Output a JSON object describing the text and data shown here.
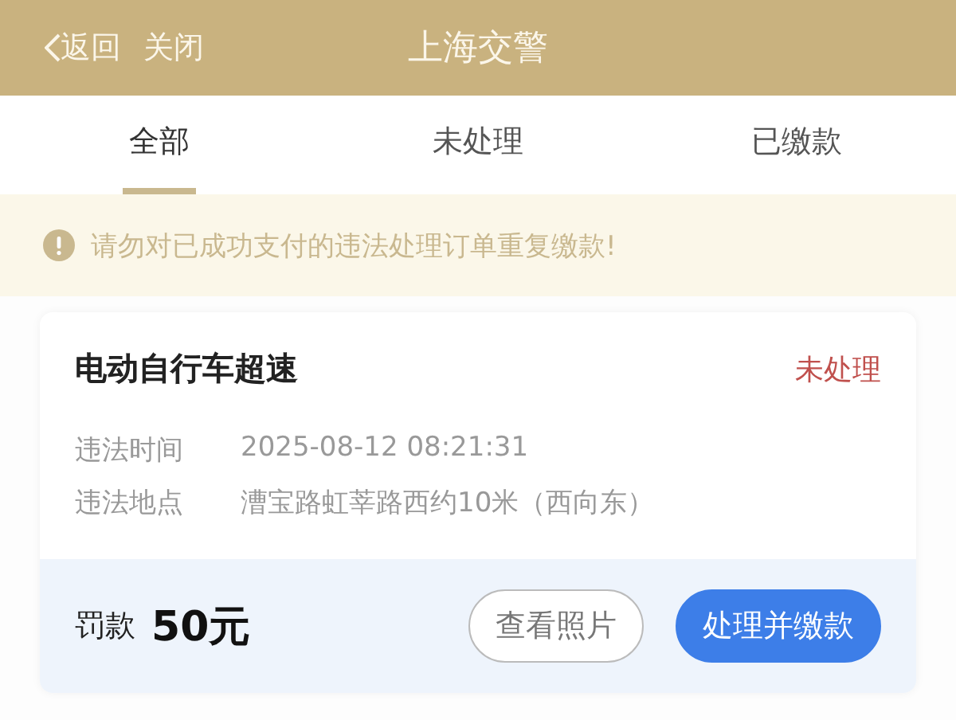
{
  "header": {
    "back": "返回",
    "close": "关闭",
    "title": "上海交警"
  },
  "tabs": [
    {
      "label": "全部",
      "selected": true
    },
    {
      "label": "未处理",
      "selected": false
    },
    {
      "label": "已缴款",
      "selected": false
    }
  ],
  "notice": "请勿对已成功支付的违法处理订单重复缴款!",
  "violations": [
    {
      "title": "电动自行车超速",
      "status": "未处理",
      "color": "#c0504d",
      "fields": [
        {
          "label": "违法时间",
          "value": "2025-08-12 08:21:31"
        },
        {
          "label": "违法地点",
          "value": "漕宝路虹莘路西约10米（西向东）"
        }
      ],
      "fine_label": "罚款",
      "fine": "50元",
      "buttons": [
        {
          "label": "查看照片",
          "kind": "outline"
        },
        {
          "label": "处理并缴款",
          "kind": "primary"
        }
      ]
    }
  ]
}
